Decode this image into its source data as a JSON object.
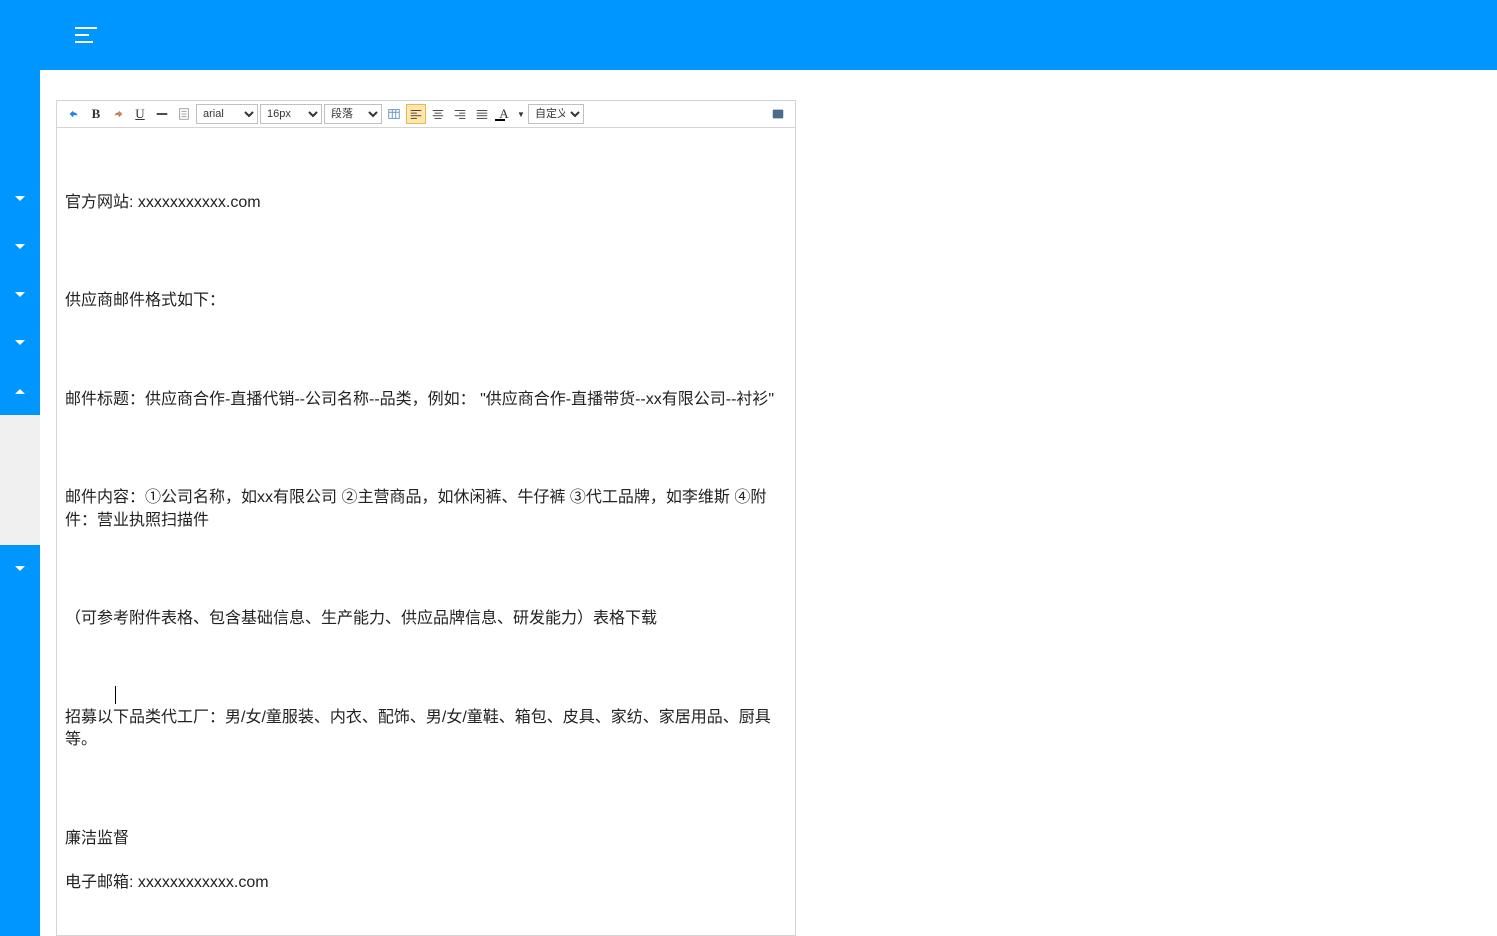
{
  "toolbar": {
    "font_value": "arial",
    "size_value": "16px",
    "format_value": "段落",
    "title_value": "自定义标题"
  },
  "content": {
    "p1": "官方网站: xxxxxxxxxxx.com",
    "p2": "供应商邮件格式如下：",
    "p3": "邮件标题：供应商合作-直播代销--公司名称--品类，例如： \"供应商合作-直播带货--xx有限公司--衬衫\"",
    "p4": "邮件内容：①公司名称，如xx有限公司 ②主营商品，如休闲裤、牛仔裤 ③代工品牌，如李维斯 ④附件：营业执照扫描件",
    "p5": "（可参考附件表格、包含基础信息、生产能力、供应品牌信息、研发能力）表格下载",
    "p6": "招募以下品类代工厂：男/女/童服装、内衣、配饰、男/女/童鞋、箱包、皮具、家纺、家居用品、厨具等。",
    "p7": "廉洁监督",
    "p8": "电子邮箱: xxxxxxxxxxxx.com"
  }
}
